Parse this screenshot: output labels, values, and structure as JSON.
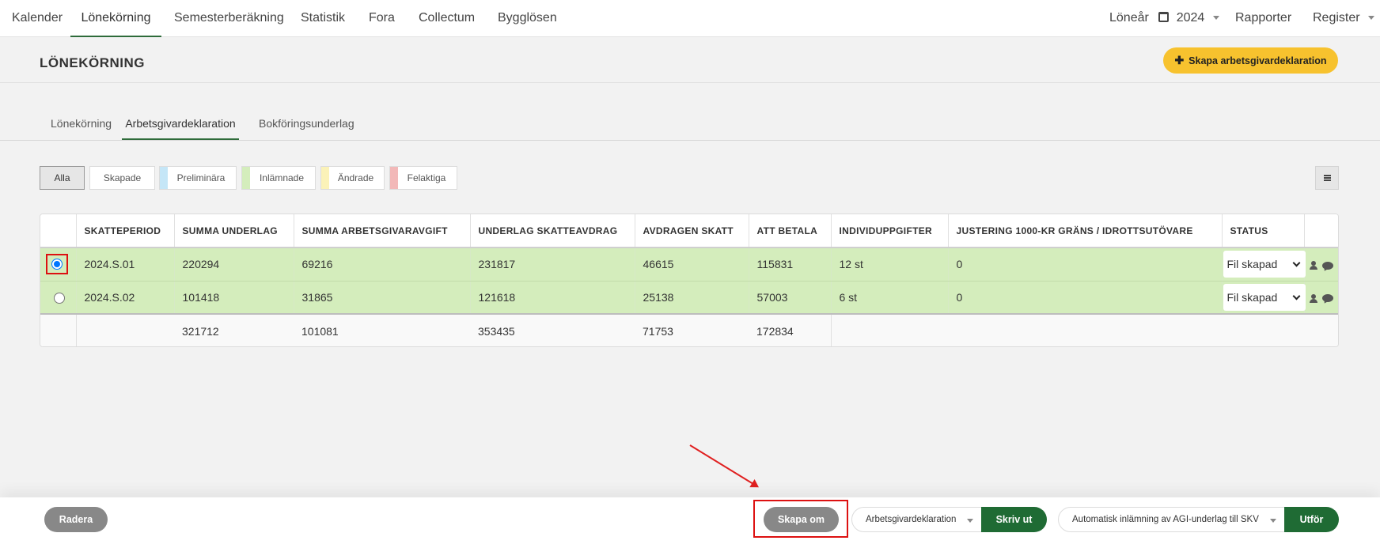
{
  "nav": {
    "left": [
      "Kalender",
      "Lönekörning",
      "Semesterberäkning",
      "Statistik",
      "Fora",
      "Collectum",
      "Bygglösen"
    ],
    "active": "Lönekörning",
    "year_label": "Löneår",
    "year_value": "2024",
    "rapporter": "Rapporter",
    "register": "Register"
  },
  "header": {
    "title": "LÖNEKÖRNING",
    "create_button": "Skapa arbetsgivardeklaration"
  },
  "tabs": [
    "Lönekörning",
    "Arbetsgivardeklaration",
    "Bokföringsunderlag"
  ],
  "active_tab": "Arbetsgivardeklaration",
  "filters": [
    {
      "label": "Alla",
      "color": ""
    },
    {
      "label": "Skapade",
      "color": ""
    },
    {
      "label": "Preliminära",
      "color": "#c5e6f7"
    },
    {
      "label": "Inlämnade",
      "color": "#d4edbc"
    },
    {
      "label": "Ändrade",
      "color": "#fbf2b8"
    },
    {
      "label": "Felaktiga",
      "color": "#f2b8b8"
    }
  ],
  "table": {
    "columns": [
      "SKATTEPERIOD",
      "SUMMA UNDERLAG",
      "SUMMA ARBETSGIVARAVGIFT",
      "UNDERLAG SKATTEAVDRAG",
      "AVDRAGEN SKATT",
      "ATT BETALA",
      "INDIVIDUPPGIFTER",
      "JUSTERING 1000-KR GRÄNS / IDROTTSUTÖVARE",
      "STATUS"
    ],
    "rows": [
      {
        "period": "2024.S.01",
        "summa_underlag": "220294",
        "summa_arbetsgivaravgift": "69216",
        "underlag_skatteavdrag": "231817",
        "avdragen_skatt": "46615",
        "att_betala": "115831",
        "individuppgifter": "12 st",
        "justering": "0",
        "status": "Fil skapad",
        "selected": true
      },
      {
        "period": "2024.S.02",
        "summa_underlag": "101418",
        "summa_arbetsgivaravgift": "31865",
        "underlag_skatteavdrag": "121618",
        "avdragen_skatt": "25138",
        "att_betala": "57003",
        "individuppgifter": "6 st",
        "justering": "0",
        "status": "Fil skapad",
        "selected": false
      }
    ],
    "totals": {
      "summa_underlag": "321712",
      "summa_arbetsgivaravgift": "101081",
      "underlag_skatteavdrag": "353435",
      "avdragen_skatt": "71753",
      "att_betala": "172834"
    }
  },
  "bottom": {
    "delete": "Radera",
    "recreate": "Skapa om",
    "print_select": "Arbetsgivardeklaration",
    "print_button": "Skriv ut",
    "submit_select": "Automatisk inlämning av AGI-underlag till SKV",
    "submit_button": "Utför"
  },
  "colors": {
    "accent_green": "#1f6b34",
    "row_green": "#d4edbc",
    "create_yellow": "#f7c22e",
    "highlight_red": "#dd1111"
  }
}
